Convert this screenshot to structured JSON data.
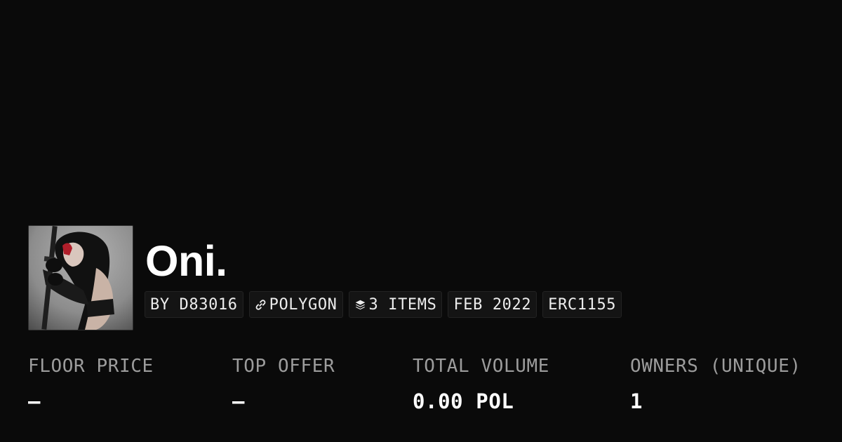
{
  "collection": {
    "name": "Oni.",
    "avatar_icon": "collection-avatar-ninja-with-sword"
  },
  "tags": {
    "creator": "BY D83016",
    "chain": {
      "label": "POLYGON",
      "icon": "chain-link-icon"
    },
    "items": {
      "label": "3 ITEMS",
      "icon": "layers-icon"
    },
    "date": "FEB 2022",
    "standard": "ERC1155"
  },
  "stats": {
    "floor_price": {
      "label": "FLOOR PRICE",
      "value": "–"
    },
    "top_offer": {
      "label": "TOP OFFER",
      "value": "–"
    },
    "total_volume": {
      "label": "TOTAL VOLUME",
      "value": "0.00 POL"
    },
    "owners": {
      "label": "OWNERS (UNIQUE)",
      "value": "1"
    }
  },
  "colors": {
    "background": "#0a0a0a",
    "tag_background": "#141414",
    "label_gray": "#9c9c9c",
    "text_white": "#ffffff"
  }
}
